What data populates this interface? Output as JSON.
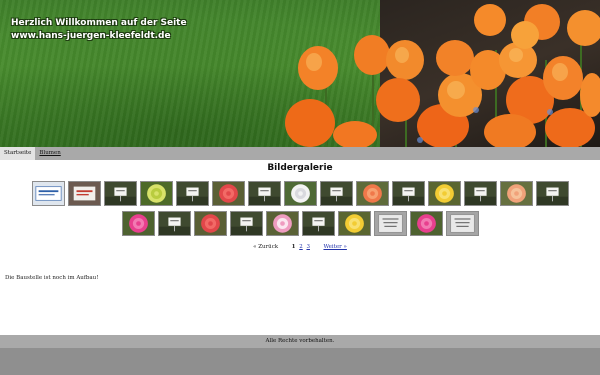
{
  "header": {
    "line1": "Herzlich Willkommen auf der Seite",
    "line2": "www.hans-juergen-kleefeldt.de"
  },
  "nav": {
    "items": [
      {
        "label": "Startseite",
        "active": true
      },
      {
        "label": "Blumen",
        "active": false
      }
    ]
  },
  "gallery": {
    "title": "Bildergalerie",
    "thumbnails_row1": [
      {
        "kind": "sign-blue"
      },
      {
        "kind": "sign-red"
      },
      {
        "kind": "plant-sign"
      },
      {
        "kind": "yellow-green"
      },
      {
        "kind": "plant-sign"
      },
      {
        "kind": "red-flower"
      },
      {
        "kind": "plant-sign"
      },
      {
        "kind": "white-flower"
      },
      {
        "kind": "plant-sign"
      },
      {
        "kind": "orange-flower"
      },
      {
        "kind": "plant-sign"
      },
      {
        "kind": "yellow-flower"
      },
      {
        "kind": "plant-sign"
      },
      {
        "kind": "peach-flower"
      },
      {
        "kind": "plant-sign"
      }
    ],
    "thumbnails_row2": [
      {
        "kind": "pink-flower"
      },
      {
        "kind": "plant-sign"
      },
      {
        "kind": "red-flower"
      },
      {
        "kind": "plant-sign"
      },
      {
        "kind": "pink-white-flower"
      },
      {
        "kind": "plant-sign"
      },
      {
        "kind": "yellow-flower"
      },
      {
        "kind": "grey-sign"
      },
      {
        "kind": "pink-flower"
      },
      {
        "kind": "grey-sign"
      }
    ]
  },
  "pager": {
    "prev": "« Zurück",
    "pages": [
      "1",
      "2",
      "3"
    ],
    "current": "1",
    "next": "Weiter »"
  },
  "notice": "Die Baustelle ist noch im Aufbau!",
  "footer": "Alle Rechte vorbehalten.",
  "colors": {
    "nav_bg": "#a9a9a9",
    "nav_active_bg": "#e3e3e3",
    "footer_bg": "#a9a9a9",
    "bottom_band": "#8f8f8f",
    "link": "#2233aa"
  }
}
